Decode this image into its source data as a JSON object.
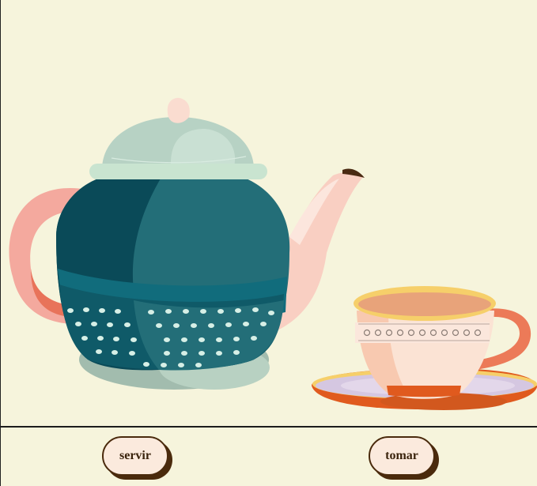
{
  "scene": {
    "teapot_icon": "teapot-icon",
    "teacup_icon": "teacup-icon",
    "colors": {
      "background": "#f6f4dc",
      "teapot_body_dark": "#0a4a58",
      "teapot_body_mid": "#236e78",
      "teapot_lid": "#b7d2c4",
      "teapot_handle": "#f4a99e",
      "teapot_spout": "#f9cfc2",
      "cup_body": "#fbe3d4",
      "cup_rim": "#f6cf6a",
      "saucer": "#e05a1e"
    }
  },
  "buttons": {
    "servir_label": "servir",
    "tomar_label": "tomar"
  }
}
